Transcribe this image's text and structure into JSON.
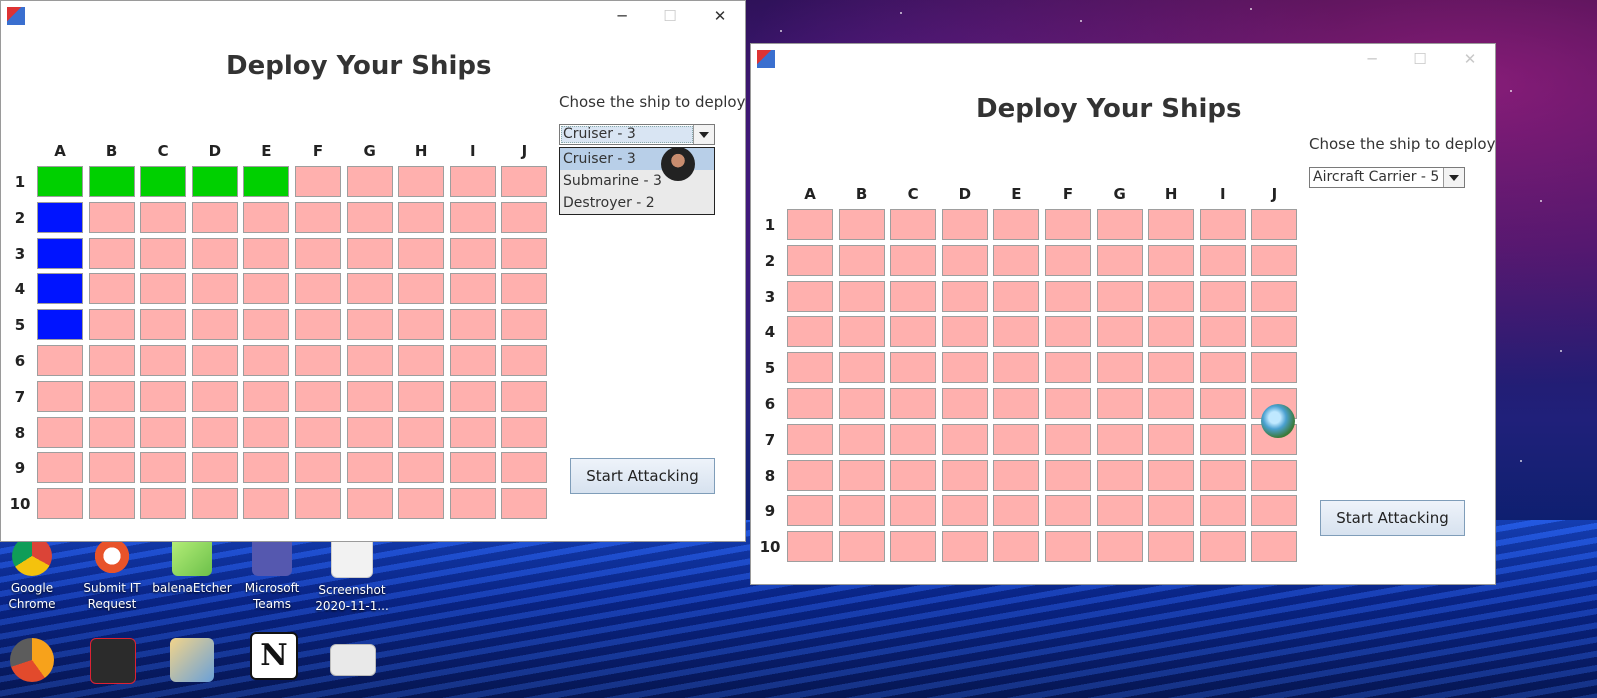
{
  "windows": [
    {
      "heading": "Deploy Your Ships",
      "chose_label": "Chose the ship to deploy",
      "combo_value": "Cruiser - 3",
      "dropdown_options": [
        "Cruiser - 3",
        "Submarine - 3",
        "Destroyer - 2"
      ],
      "start_button": "Start Attacking",
      "minimize_glyph": "─",
      "maximize_glyph": "☐",
      "close_glyph": "✕"
    },
    {
      "heading": "Deploy Your Ships",
      "chose_label": "Chose the ship to deploy",
      "combo_value": "Aircraft Carrier - 5",
      "start_button": "Start Attacking",
      "minimize_glyph": "─",
      "maximize_glyph": "☐",
      "close_glyph": "✕"
    }
  ],
  "grid": {
    "columns": [
      "A",
      "B",
      "C",
      "D",
      "E",
      "F",
      "G",
      "H",
      "I",
      "J"
    ],
    "rows": [
      "1",
      "2",
      "3",
      "4",
      "5",
      "6",
      "7",
      "8",
      "9",
      "10"
    ]
  },
  "deployed_cells": {
    "green": [
      "A1",
      "B1",
      "C1",
      "D1",
      "E1"
    ],
    "blue": [
      "A2",
      "A3",
      "A4",
      "A5"
    ]
  },
  "colors": {
    "empty_cell": "#ffb0ae",
    "green_ship": "#00d000",
    "blue_ship": "#0014ff"
  },
  "desktop_icons": [
    {
      "label": "Google Chrome",
      "icon": "chrome-icon"
    },
    {
      "label": "Submit IT Request",
      "icon": "lifebuoy-icon"
    },
    {
      "label": "balenaEtcher",
      "icon": "balena-etcher-icon"
    },
    {
      "label": "Microsoft Teams",
      "icon": "teams-icon"
    },
    {
      "label": "Screenshot 2020-11-1...",
      "icon": "screenshot-file-icon"
    }
  ],
  "taskbar_icons": [
    "chrome-canary-icon",
    "valorant-icon",
    "mail-search-icon",
    "notion-icon",
    "document-icon"
  ],
  "notion_glyph": "N"
}
